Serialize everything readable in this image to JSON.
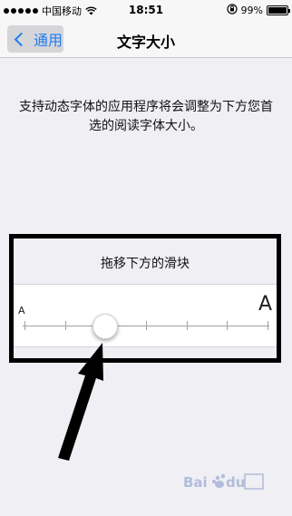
{
  "status_bar": {
    "carrier": "中国移动",
    "time": "18:51",
    "battery_percent": "99%",
    "battery_level": 0.99
  },
  "nav": {
    "back_label": "通用",
    "title": "文字大小"
  },
  "description": "支持动态字体的应用程序将会调整为下方您首选的阅读字体大小。",
  "slider": {
    "label": "拖移下方的滑块",
    "min_label": "A",
    "max_label": "A",
    "steps": 7,
    "selected_index": 2
  },
  "watermark": {
    "text": "Baidu 经验"
  }
}
